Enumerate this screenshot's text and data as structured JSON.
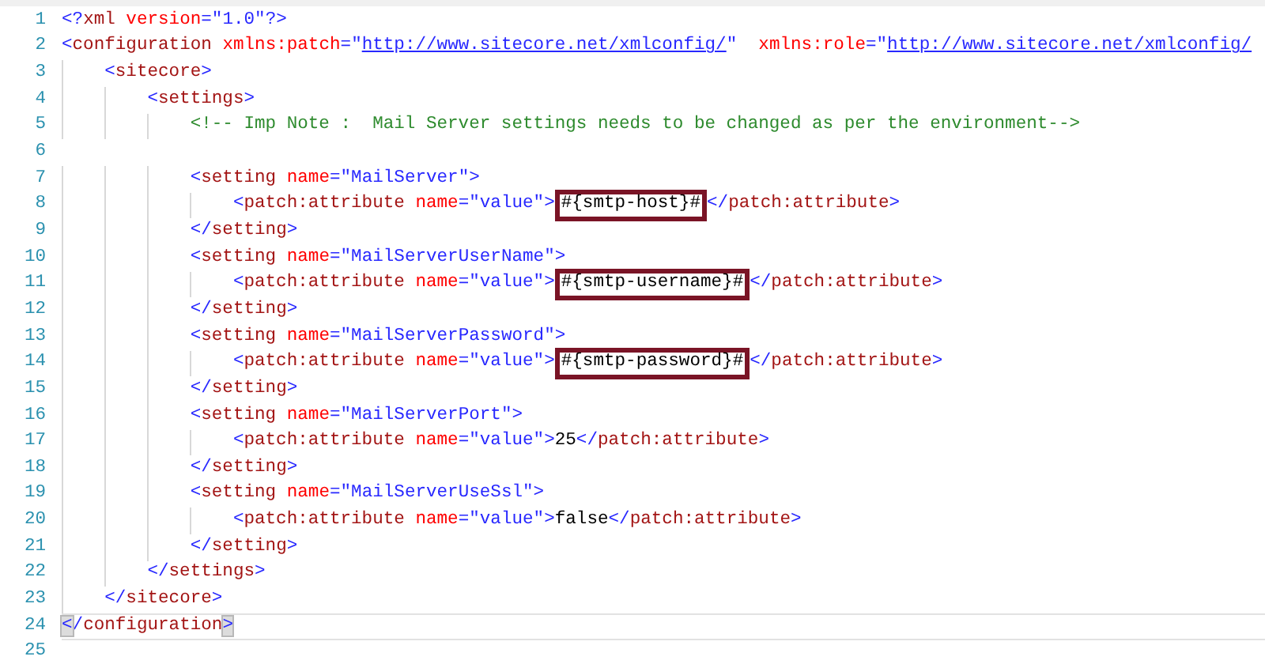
{
  "editor": {
    "lines": [
      {
        "number": "1",
        "tokens": [
          {
            "kind": "punct",
            "text": "<?"
          },
          {
            "kind": "element",
            "text": "xml"
          },
          {
            "kind": "attribute",
            "text": " version"
          },
          {
            "kind": "punct",
            "text": "="
          },
          {
            "kind": "value",
            "text": "\"1.0\""
          },
          {
            "kind": "punct",
            "text": "?>"
          }
        ]
      },
      {
        "number": "2",
        "tokens": [
          {
            "kind": "punct",
            "text": "<"
          },
          {
            "kind": "element",
            "text": "configuration"
          },
          {
            "kind": "attribute",
            "text": " xmlns:patch"
          },
          {
            "kind": "punct",
            "text": "="
          },
          {
            "kind": "value",
            "text": "\""
          },
          {
            "kind": "link",
            "text": "http://www.sitecore.net/xmlconfig/"
          },
          {
            "kind": "value",
            "text": "\""
          },
          {
            "kind": "attribute",
            "text": "  xmlns:role"
          },
          {
            "kind": "punct",
            "text": "="
          },
          {
            "kind": "value",
            "text": "\""
          },
          {
            "kind": "link",
            "text": "http://www.sitecore.net/xmlconfig/"
          }
        ]
      },
      {
        "number": "3",
        "tokens": [
          {
            "kind": "punct",
            "text": "    <"
          },
          {
            "kind": "element",
            "text": "sitecore"
          },
          {
            "kind": "punct",
            "text": ">"
          }
        ]
      },
      {
        "number": "4",
        "tokens": [
          {
            "kind": "punct",
            "text": "        <"
          },
          {
            "kind": "element",
            "text": "settings"
          },
          {
            "kind": "punct",
            "text": ">"
          }
        ]
      },
      {
        "number": "5",
        "tokens": [
          {
            "kind": "comment",
            "text": "            <!-- Imp Note :  Mail Server settings needs to be changed as per the environment-->"
          }
        ]
      },
      {
        "number": "6"
      },
      {
        "number": "7",
        "tokens": [
          {
            "kind": "punct",
            "text": "            <"
          },
          {
            "kind": "element",
            "text": "setting"
          },
          {
            "kind": "attribute",
            "text": " name"
          },
          {
            "kind": "punct",
            "text": "="
          },
          {
            "kind": "value",
            "text": "\"MailServer\""
          },
          {
            "kind": "punct",
            "text": ">"
          }
        ]
      },
      {
        "number": "8",
        "tokens": [
          {
            "kind": "punct",
            "text": "                <"
          },
          {
            "kind": "element",
            "text": "patch:attribute"
          },
          {
            "kind": "attribute",
            "text": " name"
          },
          {
            "kind": "punct",
            "text": "="
          },
          {
            "kind": "value",
            "text": "\"value\""
          },
          {
            "kind": "punct",
            "text": ">"
          },
          {
            "kind": "text",
            "text": "#{smtp-host}#",
            "boxed": true
          },
          {
            "kind": "punct",
            "text": "</"
          },
          {
            "kind": "element",
            "text": "patch:attribute"
          },
          {
            "kind": "punct",
            "text": ">"
          }
        ]
      },
      {
        "number": "9",
        "tokens": [
          {
            "kind": "punct",
            "text": "            </"
          },
          {
            "kind": "element",
            "text": "setting"
          },
          {
            "kind": "punct",
            "text": ">"
          }
        ]
      },
      {
        "number": "10",
        "tokens": [
          {
            "kind": "punct",
            "text": "            <"
          },
          {
            "kind": "element",
            "text": "setting"
          },
          {
            "kind": "attribute",
            "text": " name"
          },
          {
            "kind": "punct",
            "text": "="
          },
          {
            "kind": "value",
            "text": "\"MailServerUserName\""
          },
          {
            "kind": "punct",
            "text": ">"
          }
        ]
      },
      {
        "number": "11",
        "tokens": [
          {
            "kind": "punct",
            "text": "                <"
          },
          {
            "kind": "element",
            "text": "patch:attribute"
          },
          {
            "kind": "attribute",
            "text": " name"
          },
          {
            "kind": "punct",
            "text": "="
          },
          {
            "kind": "value",
            "text": "\"value\""
          },
          {
            "kind": "punct",
            "text": ">"
          },
          {
            "kind": "text",
            "text": "#{smtp-username}#",
            "boxed": true
          },
          {
            "kind": "punct",
            "text": "</"
          },
          {
            "kind": "element",
            "text": "patch:attribute"
          },
          {
            "kind": "punct",
            "text": ">"
          }
        ]
      },
      {
        "number": "12",
        "tokens": [
          {
            "kind": "punct",
            "text": "            </"
          },
          {
            "kind": "element",
            "text": "setting"
          },
          {
            "kind": "punct",
            "text": ">"
          }
        ]
      },
      {
        "number": "13",
        "tokens": [
          {
            "kind": "punct",
            "text": "            <"
          },
          {
            "kind": "element",
            "text": "setting"
          },
          {
            "kind": "attribute",
            "text": " name"
          },
          {
            "kind": "punct",
            "text": "="
          },
          {
            "kind": "value",
            "text": "\"MailServerPassword\""
          },
          {
            "kind": "punct",
            "text": ">"
          }
        ]
      },
      {
        "number": "14",
        "tokens": [
          {
            "kind": "punct",
            "text": "                <"
          },
          {
            "kind": "element",
            "text": "patch:attribute"
          },
          {
            "kind": "attribute",
            "text": " name"
          },
          {
            "kind": "punct",
            "text": "="
          },
          {
            "kind": "value",
            "text": "\"value\""
          },
          {
            "kind": "punct",
            "text": ">"
          },
          {
            "kind": "text",
            "text": "#{smtp-password}#",
            "boxed": true
          },
          {
            "kind": "punct",
            "text": "</"
          },
          {
            "kind": "element",
            "text": "patch:attribute"
          },
          {
            "kind": "punct",
            "text": ">"
          }
        ]
      },
      {
        "number": "15",
        "tokens": [
          {
            "kind": "punct",
            "text": "            </"
          },
          {
            "kind": "element",
            "text": "setting"
          },
          {
            "kind": "punct",
            "text": ">"
          }
        ]
      },
      {
        "number": "16",
        "tokens": [
          {
            "kind": "punct",
            "text": "            <"
          },
          {
            "kind": "element",
            "text": "setting"
          },
          {
            "kind": "attribute",
            "text": " name"
          },
          {
            "kind": "punct",
            "text": "="
          },
          {
            "kind": "value",
            "text": "\"MailServerPort\""
          },
          {
            "kind": "punct",
            "text": ">"
          }
        ]
      },
      {
        "number": "17",
        "tokens": [
          {
            "kind": "punct",
            "text": "                <"
          },
          {
            "kind": "element",
            "text": "patch:attribute"
          },
          {
            "kind": "attribute",
            "text": " name"
          },
          {
            "kind": "punct",
            "text": "="
          },
          {
            "kind": "value",
            "text": "\"value\""
          },
          {
            "kind": "punct",
            "text": ">"
          },
          {
            "kind": "text",
            "text": "25"
          },
          {
            "kind": "punct",
            "text": "</"
          },
          {
            "kind": "element",
            "text": "patch:attribute"
          },
          {
            "kind": "punct",
            "text": ">"
          }
        ]
      },
      {
        "number": "18",
        "tokens": [
          {
            "kind": "punct",
            "text": "            </"
          },
          {
            "kind": "element",
            "text": "setting"
          },
          {
            "kind": "punct",
            "text": ">"
          }
        ]
      },
      {
        "number": "19",
        "tokens": [
          {
            "kind": "punct",
            "text": "            <"
          },
          {
            "kind": "element",
            "text": "setting"
          },
          {
            "kind": "attribute",
            "text": " name"
          },
          {
            "kind": "punct",
            "text": "="
          },
          {
            "kind": "value",
            "text": "\"MailServerUseSsl\""
          },
          {
            "kind": "punct",
            "text": ">"
          }
        ]
      },
      {
        "number": "20",
        "tokens": [
          {
            "kind": "punct",
            "text": "                <"
          },
          {
            "kind": "element",
            "text": "patch:attribute"
          },
          {
            "kind": "attribute",
            "text": " name"
          },
          {
            "kind": "punct",
            "text": "="
          },
          {
            "kind": "value",
            "text": "\"value\""
          },
          {
            "kind": "punct",
            "text": ">"
          },
          {
            "kind": "text",
            "text": "false"
          },
          {
            "kind": "punct",
            "text": "</"
          },
          {
            "kind": "element",
            "text": "patch:attribute"
          },
          {
            "kind": "punct",
            "text": ">"
          }
        ]
      },
      {
        "number": "21",
        "tokens": [
          {
            "kind": "punct",
            "text": "            </"
          },
          {
            "kind": "element",
            "text": "setting"
          },
          {
            "kind": "punct",
            "text": ">"
          }
        ]
      },
      {
        "number": "22",
        "tokens": [
          {
            "kind": "punct",
            "text": "        </"
          },
          {
            "kind": "element",
            "text": "settings"
          },
          {
            "kind": "punct",
            "text": ">"
          }
        ]
      },
      {
        "number": "23",
        "tokens": [
          {
            "kind": "punct",
            "text": "    </"
          },
          {
            "kind": "element",
            "text": "sitecore"
          },
          {
            "kind": "punct",
            "text": ">"
          }
        ]
      },
      {
        "number": "24",
        "current": true,
        "tokens": [
          {
            "kind": "punct",
            "text": "<",
            "matched": true
          },
          {
            "kind": "punct",
            "text": "/"
          },
          {
            "kind": "element",
            "text": "configuration"
          },
          {
            "kind": "punct",
            "text": ">",
            "matched": true
          }
        ]
      },
      {
        "number": "25"
      }
    ]
  }
}
